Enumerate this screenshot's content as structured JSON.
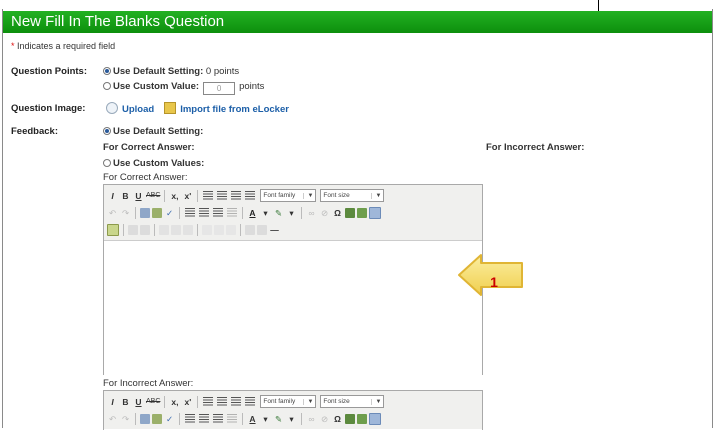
{
  "header": {
    "title": "New Fill In The Blanks Question"
  },
  "required_note": {
    "star": "*",
    "text": " Indicates a required field"
  },
  "question_points": {
    "label": "Question Points:",
    "default_option": "Use Default Setting:",
    "default_value": " 0 points",
    "custom_option": "Use Custom Value:",
    "custom_input": "0",
    "custom_unit": "points"
  },
  "question_image": {
    "label": "Question Image:",
    "upload": "Upload",
    "import": "Import file from eLocker"
  },
  "feedback": {
    "label": "Feedback:",
    "default_option": "Use Default Setting:",
    "for_correct": "For Correct Answer:",
    "for_incorrect": "For Incorrect Answer:",
    "custom_option": "Use Custom Values:",
    "correct_editor_label": "For Correct Answer:",
    "incorrect_editor_label": "For Incorrect Answer:"
  },
  "toolbar": {
    "bold": "B",
    "italic": "I",
    "underline": "U",
    "strike": "ABC",
    "subscript": "x,",
    "superscript": "x'",
    "font_family": "Font family",
    "font_size": "Font size",
    "text_color": "A",
    "omega": "Ω",
    "hr": "—"
  },
  "callout": {
    "number": "1"
  },
  "colors": {
    "header": "#18a018",
    "link": "#1c5fa8",
    "callout": "#f5dc6a"
  }
}
